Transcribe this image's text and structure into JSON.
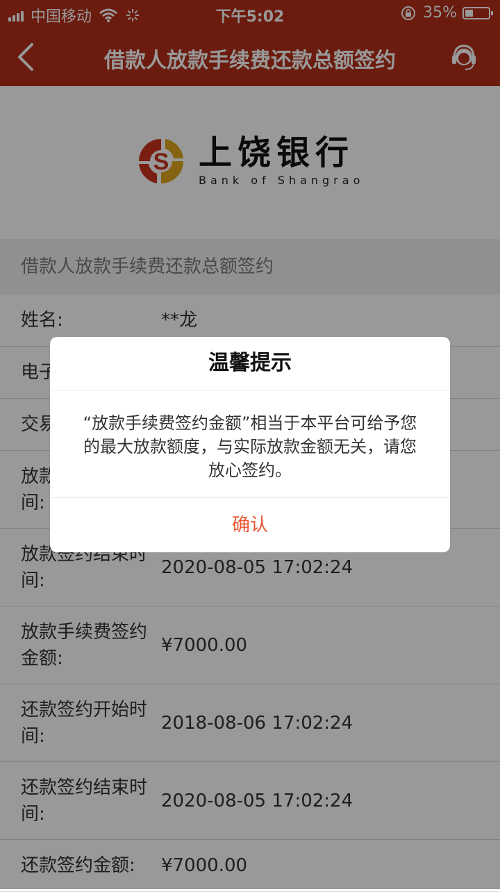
{
  "status_bar": {
    "carrier": "中国移动",
    "time": "下午5:02",
    "battery_pct": "35%",
    "battery_level": 0.35
  },
  "nav": {
    "title": "借款人放款手续费还款总额签约"
  },
  "logo": {
    "cn": "上饶银行",
    "en": "Bank of Shangrao"
  },
  "section": {
    "title": "借款人放款手续费还款总额签约"
  },
  "rows": [
    {
      "label": "姓名:",
      "value": "**龙"
    },
    {
      "label": "电子",
      "value": ""
    },
    {
      "label": "交易",
      "value": ""
    },
    {
      "label": "放款\n间:",
      "value": ""
    },
    {
      "label": "放款签约结束时\n间:",
      "value": "2020-08-05 17:02:24"
    },
    {
      "label": "放款手续费签约\n金额:",
      "value": "¥7000.00"
    },
    {
      "label": "还款签约开始时\n间:",
      "value": "2018-08-06 17:02:24"
    },
    {
      "label": "还款签约结束时\n间:",
      "value": "2020-08-05 17:02:24"
    },
    {
      "label": "还款签约金额:",
      "value": "¥7000.00"
    }
  ],
  "dialog": {
    "title": "温馨提示",
    "message": "“放款手续费签约金额”相当于本平台可给予您的最大放款额度，与实际放款金额无关，请您放心签约。",
    "confirm": "确认"
  },
  "colors": {
    "brand": "#b3301a",
    "confirm": "#e8552e"
  }
}
